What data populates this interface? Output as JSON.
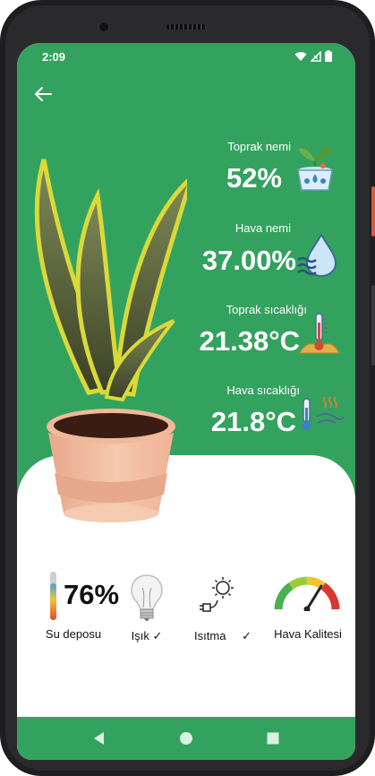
{
  "status": {
    "time": "2:09"
  },
  "readings": {
    "soil_moisture": {
      "label": "Toprak nemi",
      "value": "52%"
    },
    "air_humidity": {
      "label": "Hava nemi",
      "value": "37.00%"
    },
    "soil_temperature": {
      "label": "Toprak sıcaklığı",
      "value": "21.38°C"
    },
    "air_temperature": {
      "label": "Hava sıcaklığı",
      "value": "21.8°C"
    }
  },
  "bottom": {
    "tank": {
      "label": "Su deposu",
      "value": "76%",
      "level": 0.76
    },
    "light": {
      "label": "Işık",
      "check": "✓"
    },
    "heating": {
      "label": "Isıtma",
      "check": "✓"
    },
    "air_quality": {
      "label": "Hava Kalitesi"
    }
  },
  "icons": {
    "back": "arrow-left-icon",
    "wifi": "wifi-icon",
    "signal": "signal-icon",
    "battery": "battery-icon",
    "nav_back": "triangle-back-icon",
    "nav_home": "circle-home-icon",
    "nav_recents": "square-recents-icon"
  },
  "colors": {
    "primary_green": "#34a25f",
    "white": "#ffffff",
    "text_dark": "#111111"
  }
}
